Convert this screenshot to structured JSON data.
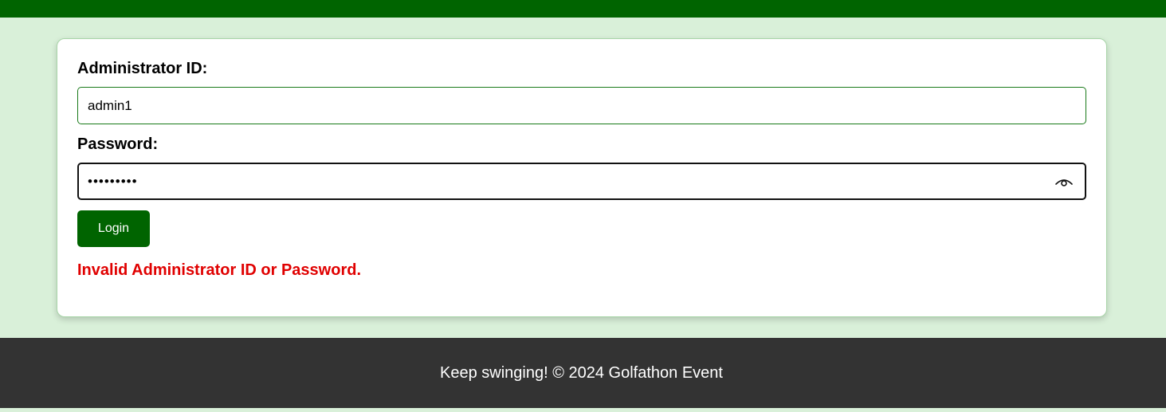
{
  "colors": {
    "brand_green": "#006400",
    "page_background": "#d9f0d9",
    "error_red": "#e00000",
    "footer_background": "#333333"
  },
  "login_form": {
    "admin_id_label": "Administrator ID:",
    "admin_id_value": "admin1",
    "password_label": "Password:",
    "password_value": "•••••••••",
    "toggle_icon": "eye-icon",
    "login_label": "Login",
    "error_message": "Invalid Administrator ID or Password."
  },
  "footer": {
    "text": "Keep swinging! © 2024 Golfathon Event"
  }
}
